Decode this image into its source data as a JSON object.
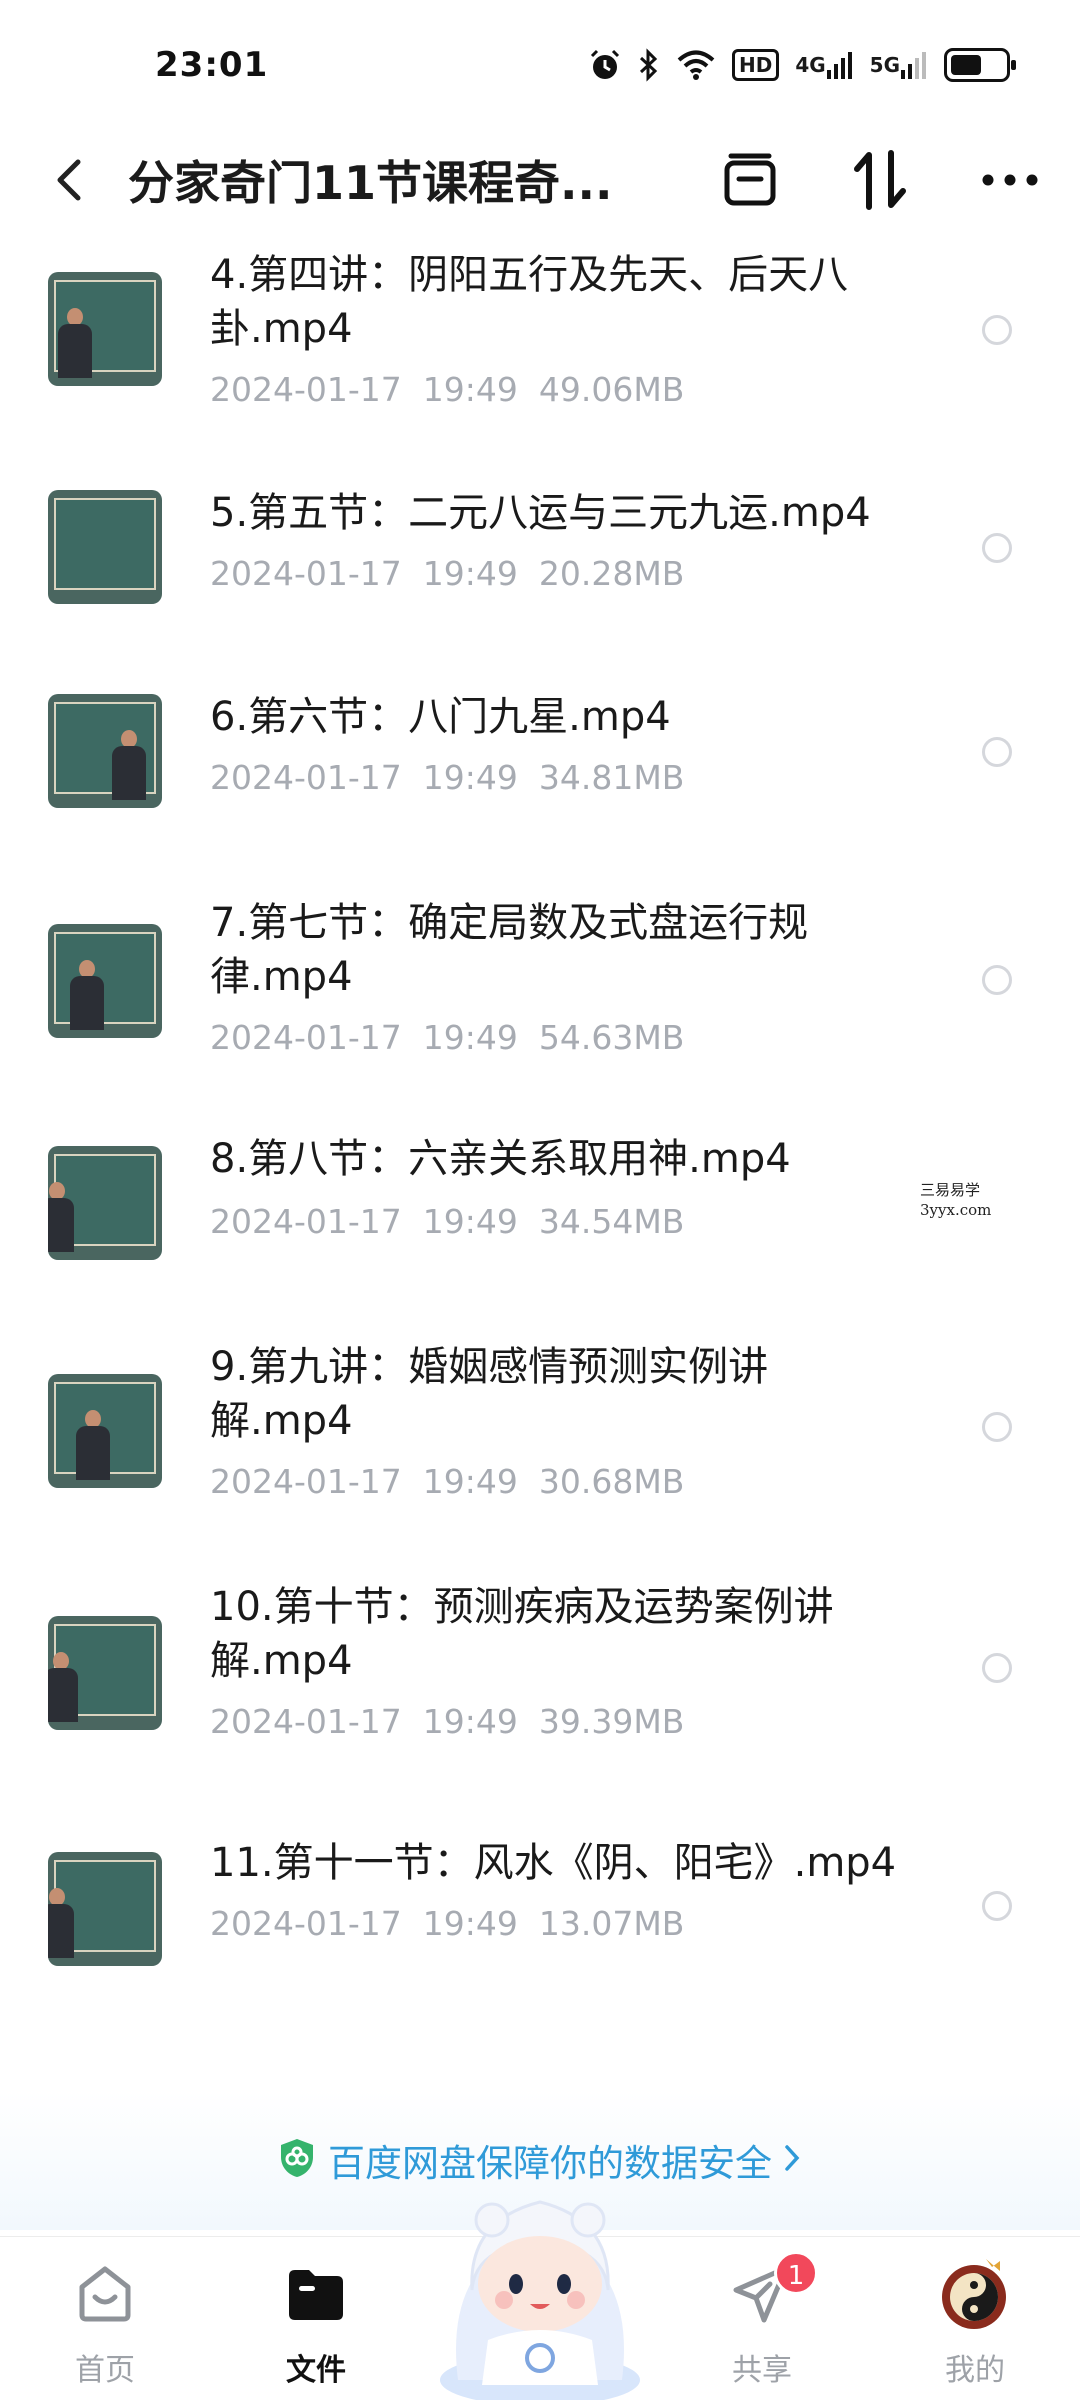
{
  "status_bar": {
    "time": "23:01",
    "hd_label": "HD",
    "net_4g": "4G",
    "net_5g": "5G"
  },
  "header": {
    "title": "分家奇门11节课程奇..."
  },
  "files": [
    {
      "name": "4.第四讲：阴阳五行及先天、后天八卦.mp4",
      "date": "2024-01-17",
      "time": "19:49",
      "size": "49.06MB"
    },
    {
      "name": "5.第五节：二元八运与三元九运.mp4",
      "date": "2024-01-17",
      "time": "19:49",
      "size": "20.28MB"
    },
    {
      "name": "6.第六节：八门九星.mp4",
      "date": "2024-01-17",
      "time": "19:49",
      "size": "34.81MB"
    },
    {
      "name": "7.第七节：确定局数及式盘运行规律.mp4",
      "date": "2024-01-17",
      "time": "19:49",
      "size": "54.63MB"
    },
    {
      "name": "8.第八节：六亲关系取用神.mp4",
      "date": "2024-01-17",
      "time": "19:49",
      "size": "34.54MB"
    },
    {
      "name": "9.第九讲：婚姻感情预测实例讲解.mp4",
      "date": "2024-01-17",
      "time": "19:49",
      "size": "30.68MB"
    },
    {
      "name": "10.第十节：预测疾病及运势案例讲解.mp4",
      "date": "2024-01-17",
      "time": "19:49",
      "size": "39.39MB"
    },
    {
      "name": "11.第十一节：风水《阴、阳宅》.mp4",
      "date": "2024-01-17",
      "time": "19:49",
      "size": "13.07MB"
    }
  ],
  "watermark": {
    "line1": "三易易学",
    "line2": "3yyx.com"
  },
  "security_banner": {
    "text": "百度网盘保障你的数据安全"
  },
  "tabs": [
    {
      "label": "首页"
    },
    {
      "label": "文件"
    },
    {
      "label": "共享",
      "badge": "1"
    },
    {
      "label": "我的"
    }
  ],
  "colors": {
    "accent": "#2f9ad8",
    "badge": "#f2485b",
    "meta": "#a7abb2"
  }
}
